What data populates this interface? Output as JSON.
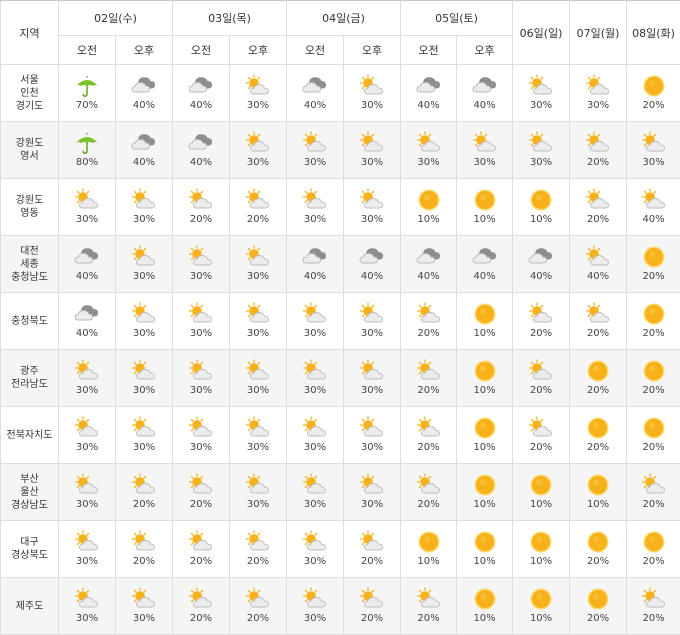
{
  "header": {
    "region_label": "지역",
    "dates_split": [
      "02일(수)",
      "03일(목)",
      "04일(금)",
      "05일(토)"
    ],
    "dates_single": [
      "06일(일)",
      "07일(월)",
      "08일(화)"
    ],
    "am_label": "오전",
    "pm_label": "오후"
  },
  "icon_names": {
    "rain": "umbrella-rain-icon",
    "cloudy": "cloudy-icon",
    "partly": "sun-behind-cloud-icon",
    "sunny": "sun-icon"
  },
  "colors": {
    "umbrella": "#7cc12a",
    "sun": "#f7b21b",
    "cloud_dark": "#8e8e8e",
    "cloud_light": "#e9e9e9",
    "border": "#dedede",
    "alt_row": "#f5f5f5"
  },
  "rows": [
    {
      "region": [
        "서울",
        "인천",
        "경기도"
      ],
      "cells": [
        {
          "icon": "rain",
          "pct": "70%"
        },
        {
          "icon": "cloudy",
          "pct": "40%"
        },
        {
          "icon": "cloudy",
          "pct": "40%"
        },
        {
          "icon": "partly",
          "pct": "30%"
        },
        {
          "icon": "cloudy",
          "pct": "40%"
        },
        {
          "icon": "partly",
          "pct": "30%"
        },
        {
          "icon": "cloudy",
          "pct": "40%"
        },
        {
          "icon": "cloudy",
          "pct": "40%"
        },
        {
          "icon": "partly",
          "pct": "30%"
        },
        {
          "icon": "partly",
          "pct": "30%"
        },
        {
          "icon": "sunny",
          "pct": "20%"
        }
      ]
    },
    {
      "region": [
        "강원도",
        "영서"
      ],
      "cells": [
        {
          "icon": "rain",
          "pct": "80%"
        },
        {
          "icon": "cloudy",
          "pct": "40%"
        },
        {
          "icon": "cloudy",
          "pct": "40%"
        },
        {
          "icon": "partly",
          "pct": "30%"
        },
        {
          "icon": "partly",
          "pct": "30%"
        },
        {
          "icon": "partly",
          "pct": "30%"
        },
        {
          "icon": "partly",
          "pct": "30%"
        },
        {
          "icon": "partly",
          "pct": "30%"
        },
        {
          "icon": "partly",
          "pct": "30%"
        },
        {
          "icon": "partly",
          "pct": "20%"
        },
        {
          "icon": "partly",
          "pct": "30%"
        }
      ]
    },
    {
      "region": [
        "강원도",
        "영동"
      ],
      "cells": [
        {
          "icon": "partly",
          "pct": "30%"
        },
        {
          "icon": "partly",
          "pct": "30%"
        },
        {
          "icon": "partly",
          "pct": "20%"
        },
        {
          "icon": "partly",
          "pct": "20%"
        },
        {
          "icon": "partly",
          "pct": "30%"
        },
        {
          "icon": "partly",
          "pct": "30%"
        },
        {
          "icon": "sunny",
          "pct": "10%"
        },
        {
          "icon": "sunny",
          "pct": "10%"
        },
        {
          "icon": "sunny",
          "pct": "10%"
        },
        {
          "icon": "partly",
          "pct": "20%"
        },
        {
          "icon": "partly",
          "pct": "40%"
        }
      ]
    },
    {
      "region": [
        "대전",
        "세종",
        "충청남도"
      ],
      "cells": [
        {
          "icon": "cloudy",
          "pct": "40%"
        },
        {
          "icon": "partly",
          "pct": "30%"
        },
        {
          "icon": "partly",
          "pct": "30%"
        },
        {
          "icon": "partly",
          "pct": "30%"
        },
        {
          "icon": "cloudy",
          "pct": "40%"
        },
        {
          "icon": "cloudy",
          "pct": "40%"
        },
        {
          "icon": "cloudy",
          "pct": "40%"
        },
        {
          "icon": "cloudy",
          "pct": "40%"
        },
        {
          "icon": "cloudy",
          "pct": "40%"
        },
        {
          "icon": "partly",
          "pct": "40%"
        },
        {
          "icon": "sunny",
          "pct": "20%"
        }
      ]
    },
    {
      "region": [
        "충청북도"
      ],
      "cells": [
        {
          "icon": "cloudy",
          "pct": "40%"
        },
        {
          "icon": "partly",
          "pct": "30%"
        },
        {
          "icon": "partly",
          "pct": "30%"
        },
        {
          "icon": "partly",
          "pct": "30%"
        },
        {
          "icon": "partly",
          "pct": "30%"
        },
        {
          "icon": "partly",
          "pct": "30%"
        },
        {
          "icon": "partly",
          "pct": "20%"
        },
        {
          "icon": "sunny",
          "pct": "10%"
        },
        {
          "icon": "partly",
          "pct": "20%"
        },
        {
          "icon": "partly",
          "pct": "20%"
        },
        {
          "icon": "sunny",
          "pct": "20%"
        }
      ]
    },
    {
      "region": [
        "광주",
        "전라남도"
      ],
      "cells": [
        {
          "icon": "partly",
          "pct": "30%"
        },
        {
          "icon": "partly",
          "pct": "30%"
        },
        {
          "icon": "partly",
          "pct": "30%"
        },
        {
          "icon": "partly",
          "pct": "30%"
        },
        {
          "icon": "partly",
          "pct": "30%"
        },
        {
          "icon": "partly",
          "pct": "30%"
        },
        {
          "icon": "partly",
          "pct": "20%"
        },
        {
          "icon": "sunny",
          "pct": "10%"
        },
        {
          "icon": "partly",
          "pct": "20%"
        },
        {
          "icon": "sunny",
          "pct": "20%"
        },
        {
          "icon": "sunny",
          "pct": "20%"
        }
      ]
    },
    {
      "region": [
        "전북자치도"
      ],
      "cells": [
        {
          "icon": "partly",
          "pct": "30%"
        },
        {
          "icon": "partly",
          "pct": "30%"
        },
        {
          "icon": "partly",
          "pct": "30%"
        },
        {
          "icon": "partly",
          "pct": "30%"
        },
        {
          "icon": "partly",
          "pct": "30%"
        },
        {
          "icon": "partly",
          "pct": "30%"
        },
        {
          "icon": "partly",
          "pct": "20%"
        },
        {
          "icon": "sunny",
          "pct": "10%"
        },
        {
          "icon": "partly",
          "pct": "20%"
        },
        {
          "icon": "sunny",
          "pct": "20%"
        },
        {
          "icon": "sunny",
          "pct": "20%"
        }
      ]
    },
    {
      "region": [
        "부산",
        "울산",
        "경상남도"
      ],
      "cells": [
        {
          "icon": "partly",
          "pct": "30%"
        },
        {
          "icon": "partly",
          "pct": "20%"
        },
        {
          "icon": "partly",
          "pct": "20%"
        },
        {
          "icon": "partly",
          "pct": "30%"
        },
        {
          "icon": "partly",
          "pct": "30%"
        },
        {
          "icon": "partly",
          "pct": "30%"
        },
        {
          "icon": "partly",
          "pct": "20%"
        },
        {
          "icon": "sunny",
          "pct": "10%"
        },
        {
          "icon": "sunny",
          "pct": "10%"
        },
        {
          "icon": "sunny",
          "pct": "10%"
        },
        {
          "icon": "partly",
          "pct": "20%"
        }
      ]
    },
    {
      "region": [
        "대구",
        "경상북도"
      ],
      "cells": [
        {
          "icon": "partly",
          "pct": "30%"
        },
        {
          "icon": "partly",
          "pct": "20%"
        },
        {
          "icon": "partly",
          "pct": "20%"
        },
        {
          "icon": "partly",
          "pct": "20%"
        },
        {
          "icon": "partly",
          "pct": "30%"
        },
        {
          "icon": "partly",
          "pct": "20%"
        },
        {
          "icon": "sunny",
          "pct": "10%"
        },
        {
          "icon": "sunny",
          "pct": "10%"
        },
        {
          "icon": "sunny",
          "pct": "10%"
        },
        {
          "icon": "sunny",
          "pct": "20%"
        },
        {
          "icon": "sunny",
          "pct": "20%"
        }
      ]
    },
    {
      "region": [
        "제주도"
      ],
      "cells": [
        {
          "icon": "partly",
          "pct": "30%"
        },
        {
          "icon": "partly",
          "pct": "30%"
        },
        {
          "icon": "partly",
          "pct": "20%"
        },
        {
          "icon": "partly",
          "pct": "20%"
        },
        {
          "icon": "partly",
          "pct": "30%"
        },
        {
          "icon": "partly",
          "pct": "20%"
        },
        {
          "icon": "partly",
          "pct": "20%"
        },
        {
          "icon": "sunny",
          "pct": "10%"
        },
        {
          "icon": "sunny",
          "pct": "10%"
        },
        {
          "icon": "sunny",
          "pct": "20%"
        },
        {
          "icon": "partly",
          "pct": "20%"
        }
      ]
    }
  ]
}
